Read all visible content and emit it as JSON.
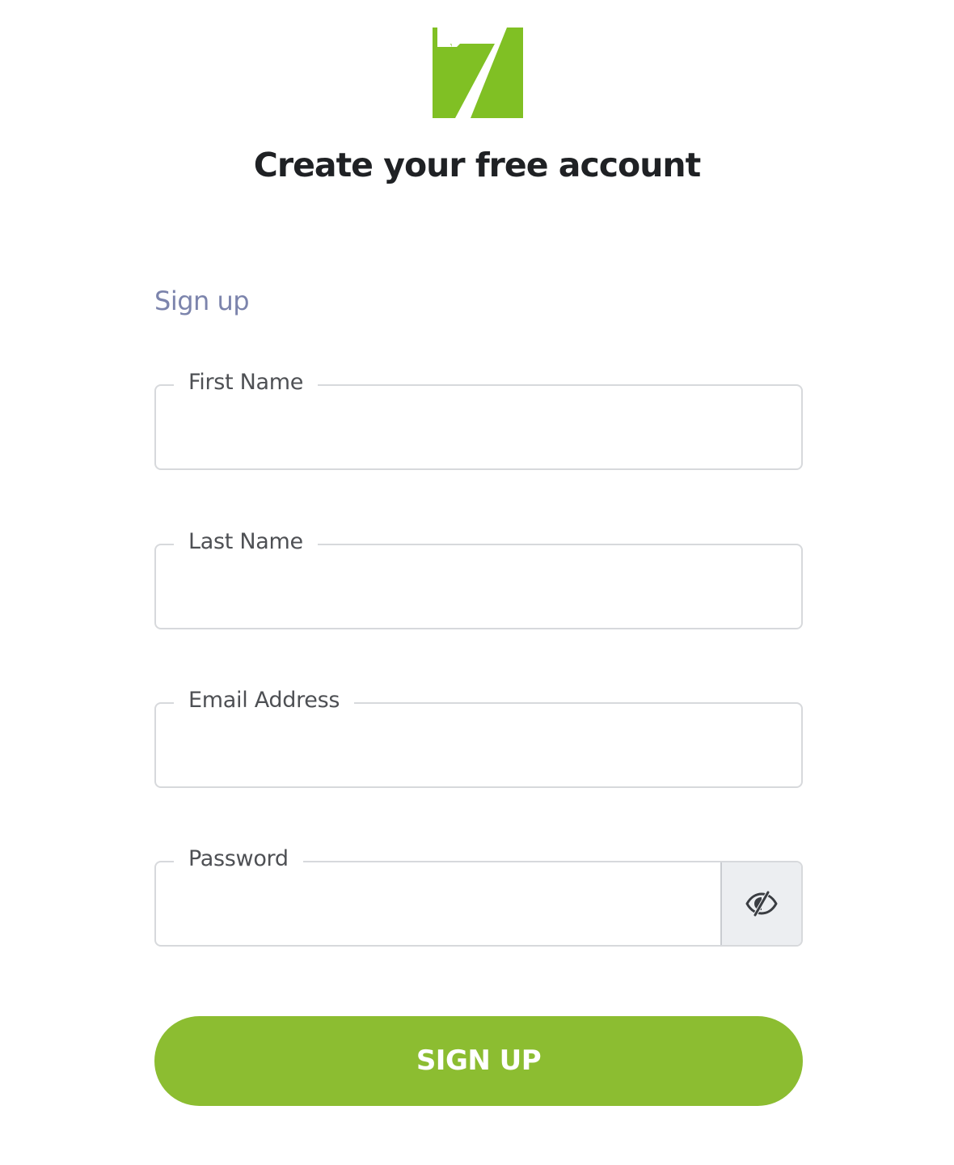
{
  "brand": {
    "logo_icon": "seven-logo-icon",
    "logo_color": "#80c024"
  },
  "header": {
    "title": "Create your free account"
  },
  "form": {
    "heading": "Sign up",
    "heading_color": "#7c84ac",
    "fields": [
      {
        "label": "First Name",
        "value": "",
        "type": "text"
      },
      {
        "label": "Last Name",
        "value": "",
        "type": "text"
      },
      {
        "label": "Email Address",
        "value": "",
        "type": "email"
      },
      {
        "label": "Password",
        "value": "",
        "type": "password"
      }
    ],
    "password_toggle_icon": "eye-slash-icon",
    "submit_label": "SIGN UP",
    "submit_color": "#8cbd31"
  }
}
